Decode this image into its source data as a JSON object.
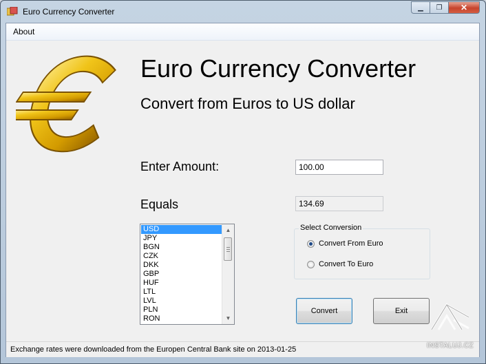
{
  "window": {
    "title": "Euro Currency Converter"
  },
  "menu": {
    "about": "About"
  },
  "header": {
    "title": "Euro Currency Converter",
    "subtitle": "Convert from Euros to US dollar"
  },
  "form": {
    "amount_label": "Enter Amount:",
    "amount_value": "100.00",
    "equals_label": "Equals",
    "result_value": "134.69"
  },
  "currency_list": {
    "selected": "USD",
    "items": [
      "USD",
      "JPY",
      "BGN",
      "CZK",
      "DKK",
      "GBP",
      "HUF",
      "LTL",
      "LVL",
      "PLN",
      "RON"
    ]
  },
  "conversion": {
    "group_title": "Select Conversion",
    "options": [
      {
        "label": "Convert From Euro",
        "checked": true
      },
      {
        "label": "Convert To Euro",
        "checked": false
      }
    ]
  },
  "buttons": {
    "convert": "Convert",
    "exit": "Exit"
  },
  "status": {
    "text": "Exchange rates were downloaded from the Europen Central Bank site on 2013-01-25"
  },
  "watermark": {
    "text": "INSTALUJ.CZ"
  },
  "colors": {
    "selection": "#3399ff",
    "logo_gold": "#e0b000",
    "close_button": "#c7432c"
  }
}
